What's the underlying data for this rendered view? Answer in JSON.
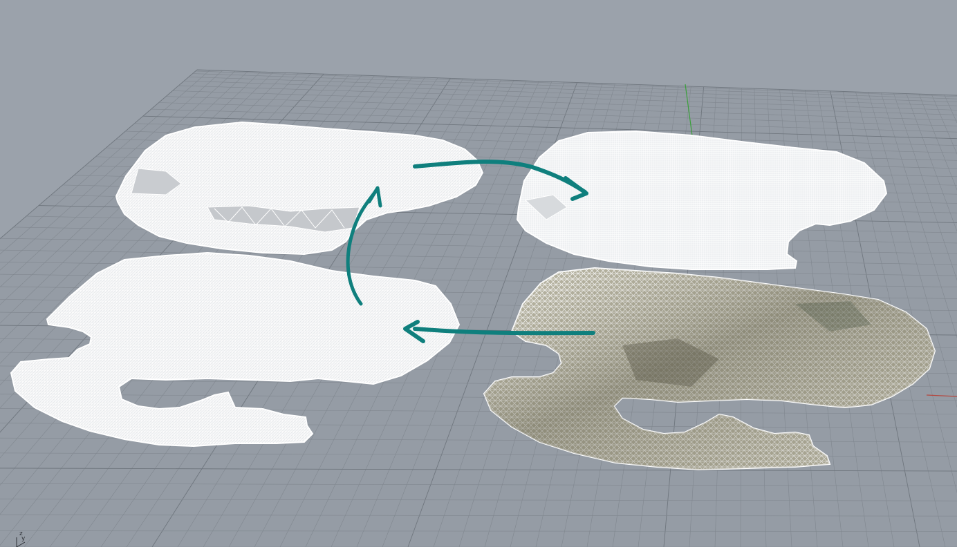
{
  "viewport": {
    "name": "Perspective",
    "background_color": "#9ba2ab",
    "grid_color": "#80878f",
    "grid_major_color": "#6f767e",
    "x_axis_color": "#b5473f",
    "y_axis_color": "#3aa03a",
    "mesh_wire_color": "#ffffff",
    "textured_mesh_colors": [
      "#8c8a73",
      "#a7a48e",
      "#6d6b5c",
      "#c9c6b5",
      "#585648"
    ],
    "arrow_color": "#0f7f7d"
  },
  "axis_indicator": {
    "z_label": "z",
    "y_label": "y"
  },
  "meshes": [
    {
      "id": "mesh-top-left",
      "kind": "wireframe",
      "note_icon": "mesh-icon"
    },
    {
      "id": "mesh-top-right",
      "kind": "wireframe",
      "note_icon": "mesh-icon"
    },
    {
      "id": "mesh-bottom-left",
      "kind": "wireframe",
      "note_icon": "mesh-icon"
    },
    {
      "id": "mesh-bottom-right",
      "kind": "textured-wireframe",
      "note_icon": "mesh-icon"
    }
  ],
  "annotations": [
    {
      "id": "arrow-top-left-to-top-right",
      "icon": "curved-arrow-icon"
    },
    {
      "id": "arrow-bottom-left-to-top-left",
      "icon": "curved-arrow-icon"
    },
    {
      "id": "arrow-bottom-right-to-bottom-left",
      "icon": "arrow-left-icon"
    }
  ]
}
